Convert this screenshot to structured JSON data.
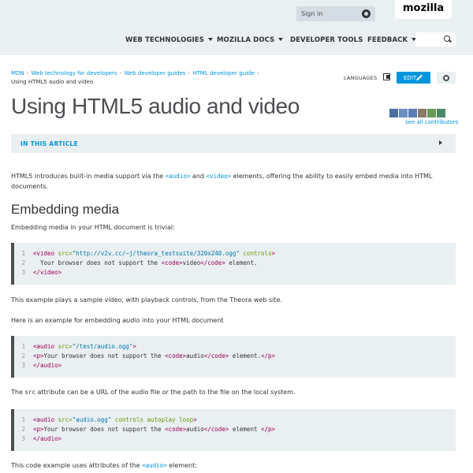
{
  "header": {
    "signin_label": "Sign in",
    "logo": "mozilla",
    "nav": [
      {
        "label": "WEB TECHNOLOGIES",
        "has_caret": true
      },
      {
        "label": "MOZILLA DOCS",
        "has_caret": true
      },
      {
        "label": "DEVELOPER TOOLS",
        "has_caret": false
      },
      {
        "label": "FEEDBACK",
        "has_caret": true
      }
    ],
    "search_placeholder": ""
  },
  "breadcrumb": {
    "items": [
      "MDN",
      "Web technology for developers",
      "Web developer guides",
      "HTML developer guide"
    ],
    "current": "Using HTML5 audio and video"
  },
  "tools": {
    "languages_label": "LANGUAGES",
    "edit_label": "EDIT"
  },
  "page": {
    "title": "Using HTML5 audio and video",
    "contributors_link": "see all contributors",
    "article_toggle": "IN THIS ARTICLE"
  },
  "content": {
    "intro_pre": "HTML5 introduces built-in media support via the ",
    "intro_code1": "<audio>",
    "intro_mid": " and ",
    "intro_code2": "<video>",
    "intro_post": " elements, offering the ability to easily embed media into HTML documents.",
    "heading": "Embedding media",
    "embed_text": "Embedding media in your HTML document is trivial:",
    "code1": [
      {
        "n": "1",
        "parts": [
          [
            "tag",
            "<video "
          ],
          [
            "attr",
            "src="
          ],
          [
            "val",
            "\"http://v2v.cc/~j/theora_testsuite/320x240.ogg\""
          ],
          [
            "attr",
            " controls"
          ],
          [
            "tag",
            ">"
          ]
        ]
      },
      {
        "n": "2",
        "parts": [
          [
            "txt",
            "  Your browser does not support the "
          ],
          [
            "tag",
            "<code>"
          ],
          [
            "txt",
            "video"
          ],
          [
            "tag",
            "</code>"
          ],
          [
            "txt",
            " element."
          ]
        ]
      },
      {
        "n": "3",
        "parts": [
          [
            "tag",
            "</video>"
          ]
        ]
      }
    ],
    "after_code1": "This example plays a sample video, with playback controls, from the Theora web site.",
    "audio_pre": "Here is an example for embedding ",
    "audio_em": "audio",
    "audio_post": " into your HTML document",
    "code2": [
      {
        "n": "1",
        "parts": [
          [
            "tag",
            "<audio "
          ],
          [
            "attr",
            "src="
          ],
          [
            "val",
            "\"/test/audio.ogg\""
          ],
          [
            "tag",
            ">"
          ]
        ]
      },
      {
        "n": "2",
        "parts": [
          [
            "tag",
            "<p>"
          ],
          [
            "txt",
            "Your browser does not support the "
          ],
          [
            "tag",
            "<code>"
          ],
          [
            "txt",
            "audio"
          ],
          [
            "tag",
            "</code>"
          ],
          [
            "txt",
            " element."
          ],
          [
            "tag",
            "</p>"
          ]
        ]
      },
      {
        "n": "3",
        "parts": [
          [
            "tag",
            "</audio>"
          ]
        ]
      }
    ],
    "src_pre": "The ",
    "src_code": "src",
    "src_post": " attribute can be a URL of the audio file or the path to the file on the local system.",
    "code3": [
      {
        "n": "1",
        "parts": [
          [
            "tag",
            "<audio "
          ],
          [
            "attr",
            "src="
          ],
          [
            "val",
            "\"audio.ogg\""
          ],
          [
            "attr",
            " controls autoplay loop"
          ],
          [
            "tag",
            ">"
          ]
        ]
      },
      {
        "n": "2",
        "parts": [
          [
            "tag",
            "<p>"
          ],
          [
            "txt",
            "Your browser does not support the "
          ],
          [
            "tag",
            "<code>"
          ],
          [
            "txt",
            "audio"
          ],
          [
            "tag",
            "</code>"
          ],
          [
            "txt",
            " element "
          ],
          [
            "tag",
            "</p>"
          ]
        ]
      },
      {
        "n": "3",
        "parts": [
          [
            "tag",
            "</audio>"
          ]
        ]
      }
    ],
    "last_pre": "This code example uses attributes of the ",
    "last_code": "<audio>",
    "last_post": " element:"
  },
  "colors": {
    "accent": "#0095dd",
    "header_bg": "#eaeff2",
    "code_bg": "#eaeff2"
  }
}
